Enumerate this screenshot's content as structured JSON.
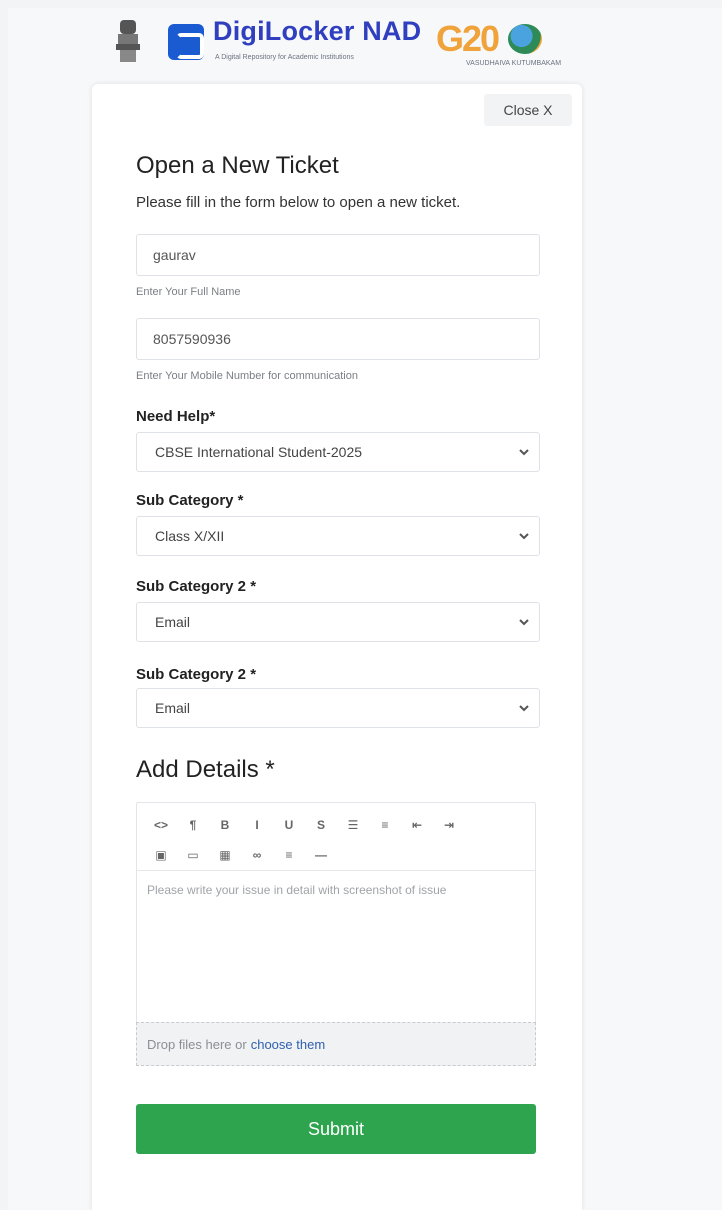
{
  "header": {
    "brand_name": "DigiLocker NAD",
    "brand_tagline": "A Digital Repository for Academic Institutions",
    "g20_text": "G20",
    "g20_tagline": "VASUDHAIVA KUTUMBAKAM"
  },
  "close_label": "Close X",
  "form": {
    "title": "Open a New Ticket",
    "subtitle": "Please fill in the form below to open a new ticket.",
    "name_value": "gaurav",
    "name_hint": "Enter Your Full Name",
    "mobile_value": "8057590936",
    "mobile_hint": "Enter Your Mobile Number for communication",
    "need_help_label": "Need Help*",
    "need_help_value": "CBSE International Student-2025",
    "subcat_label": "Sub Category *",
    "subcat_value": "Class X/XII",
    "subcat2_label": "Sub Category 2 *",
    "subcat2_value": "Email",
    "subcat2b_label": "Sub Category 2 *",
    "subcat2b_value": "Email",
    "details_label": "Add Details *",
    "editor_placeholder": "Please write your issue in detail with screenshot of issue",
    "dropzone_text": "Drop files here or",
    "dropzone_link": "choose them",
    "submit_label": "Submit"
  },
  "toolbar": {
    "row1": [
      "<>",
      "¶",
      "B",
      "I",
      "U",
      "S",
      "☰",
      "≡",
      "⇤",
      "⇥"
    ],
    "row2": [
      "▣",
      "▭",
      "▦",
      "∞",
      "≡",
      "—"
    ]
  },
  "colors": {
    "brand": "#2f3fbf",
    "submit": "#2ea44f",
    "link": "#2f5fb0"
  }
}
